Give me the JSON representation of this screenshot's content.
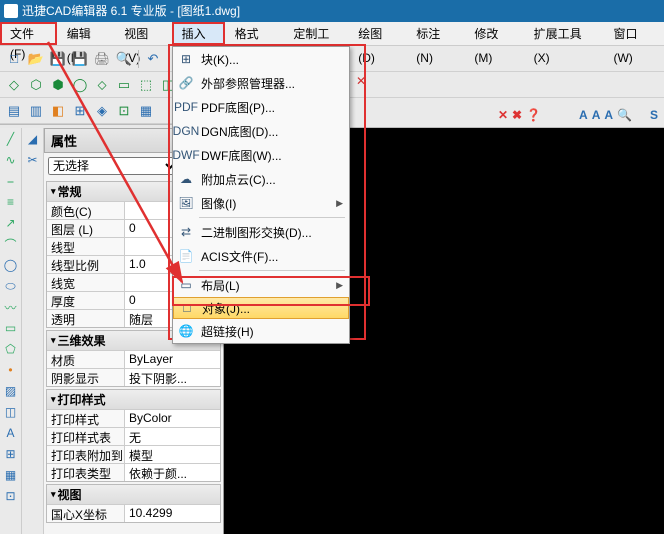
{
  "title": "迅捷CAD编辑器 6.1 专业版  - [图纸1.dwg]",
  "menubar": {
    "file": "文件(F)",
    "edit": "编辑(E)",
    "view": "视图(V)",
    "insert": "插入(I)",
    "format": "格式(O)",
    "customtools": "定制工具",
    "draw": "绘图(D)",
    "annotate": "标注(N)",
    "modify": "修改(M)",
    "ext": "扩展工具(X)",
    "window": "窗口(W)"
  },
  "dropdown": {
    "items": [
      {
        "label": "块(K)..."
      },
      {
        "label": "外部参照管理器..."
      },
      {
        "label": "PDF底图(P)..."
      },
      {
        "label": "DGN底图(D)..."
      },
      {
        "label": "DWF底图(W)..."
      },
      {
        "label": "附加点云(C)..."
      },
      {
        "label": "图像(I)",
        "sub": true
      },
      {
        "sep": true
      },
      {
        "label": "二进制图形交换(D)..."
      },
      {
        "label": "ACIS文件(F)..."
      },
      {
        "sep": true
      },
      {
        "label": "布局(L)",
        "sub": true
      },
      {
        "label": "对象(J)...",
        "hl": true
      },
      {
        "label": "超链接(H)"
      }
    ]
  },
  "props": {
    "title": "属性",
    "select_none": "无选择",
    "groups": [
      {
        "name": "常规",
        "rows": [
          [
            "颜色(C)",
            ""
          ],
          [
            "图层 (L)",
            "0"
          ],
          [
            "线型",
            ""
          ],
          [
            "线型比例",
            "1.0"
          ],
          [
            "线宽",
            ""
          ],
          [
            "厚度",
            "0"
          ],
          [
            "透明",
            "随层"
          ]
        ]
      },
      {
        "name": "三维效果",
        "rows": [
          [
            "材质",
            "ByLayer"
          ],
          [
            "阴影显示",
            "投下阴影..."
          ]
        ]
      },
      {
        "name": "打印样式",
        "rows": [
          [
            "打印样式",
            "ByColor"
          ],
          [
            "打印样式表",
            "无"
          ],
          [
            "打印表附加到",
            "模型"
          ],
          [
            "打印表类型",
            "依赖于颜..."
          ]
        ]
      },
      {
        "name": "视图",
        "rows": [
          [
            "国心X坐标",
            "10.4299"
          ]
        ]
      }
    ]
  },
  "rtool": {
    "a": "A",
    "s": "S"
  }
}
